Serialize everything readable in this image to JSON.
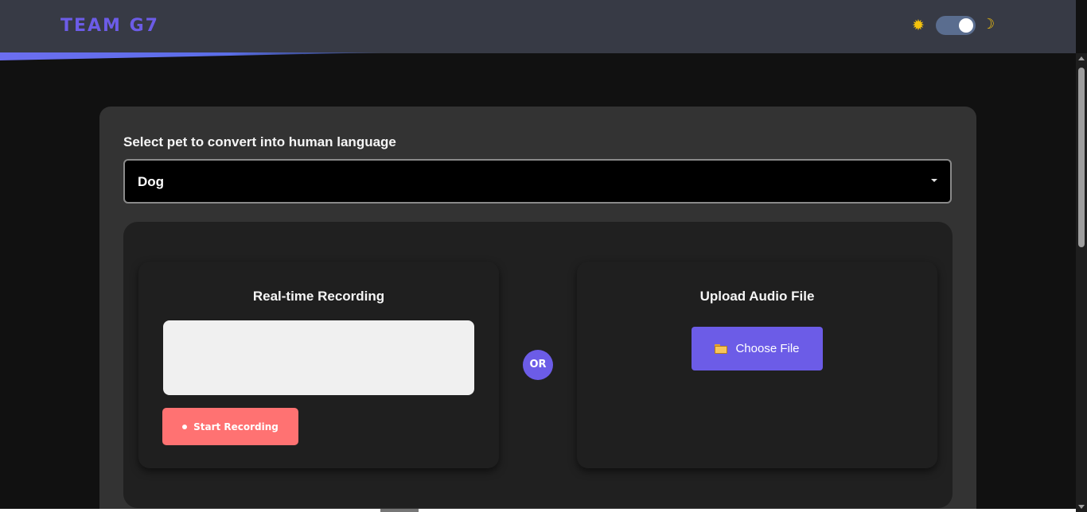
{
  "header": {
    "logo": "TEAM G7",
    "theme_toggle": {
      "sun_icon": "sun-icon",
      "moon_icon": "moon-icon",
      "state": "dark"
    }
  },
  "form": {
    "select_label": "Select pet to convert into human language",
    "pet_select": {
      "value": "Dog"
    }
  },
  "recording": {
    "title": "Real-time Recording",
    "start_label": "Start Recording"
  },
  "divider": {
    "label": "OR"
  },
  "upload": {
    "title": "Upload Audio File",
    "choose_label": "Choose File"
  },
  "colors": {
    "accent": "#6c5ce7",
    "record": "#ff7272",
    "header_bg": "#373a45",
    "page_bg": "#111111"
  }
}
